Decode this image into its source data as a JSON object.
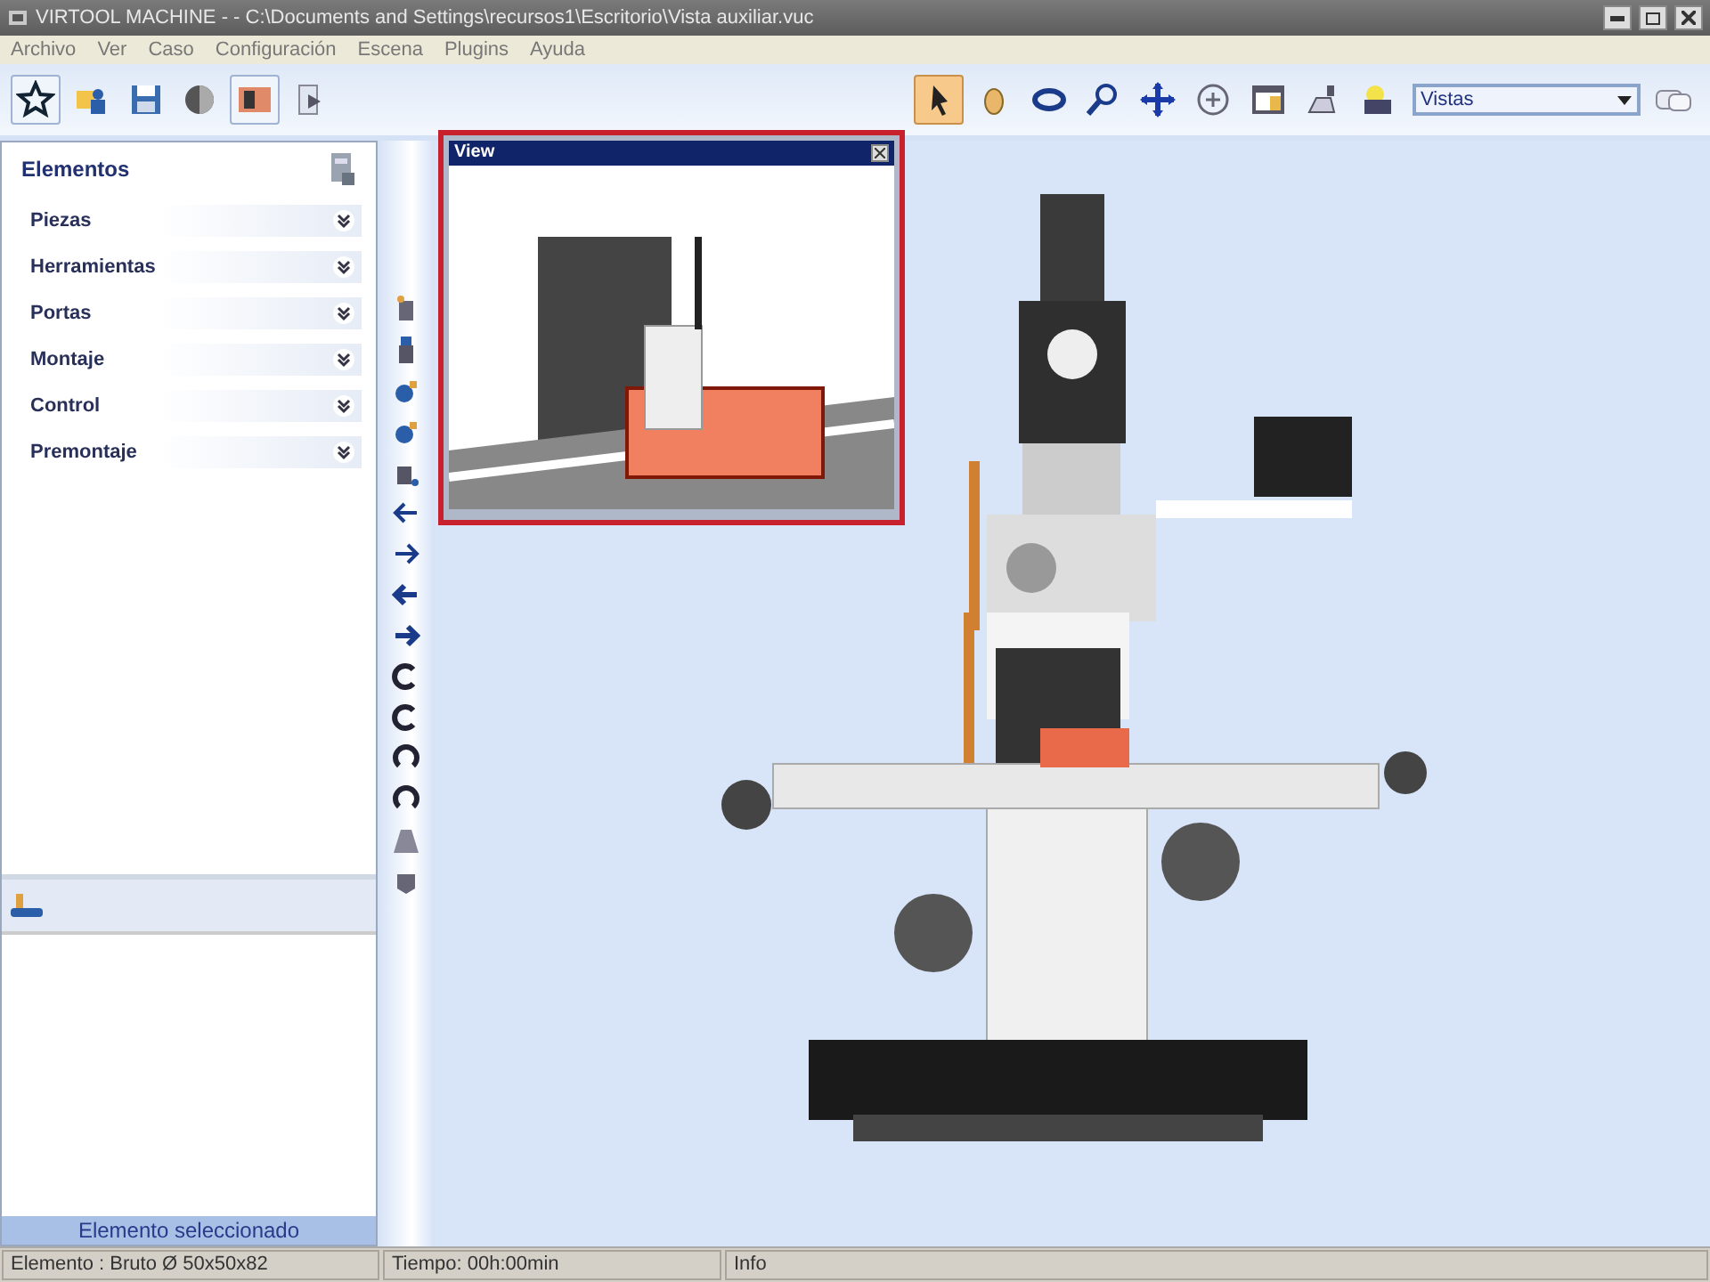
{
  "window": {
    "title": "VIRTOOL MACHINE - - C:\\Documents and Settings\\recursos1\\Escritorio\\Vista auxiliar.vuc"
  },
  "menu": [
    "Archivo",
    "Ver",
    "Caso",
    "Configuración",
    "Escena",
    "Plugins",
    "Ayuda"
  ],
  "file_toolbar": [
    {
      "selected": true
    },
    {
      "selected": false
    },
    {
      "selected": false
    },
    {
      "selected": false
    },
    {
      "selected": true
    },
    {
      "selected": false
    }
  ],
  "view_toolbar": [
    {
      "selected": true
    },
    {
      "selected": false
    },
    {
      "selected": false
    },
    {
      "selected": false
    },
    {
      "selected": false
    },
    {
      "selected": false
    },
    {
      "selected": false
    },
    {
      "selected": false
    },
    {
      "selected": false
    }
  ],
  "views_dropdown": {
    "value": "Vistas"
  },
  "sidebar": {
    "title": "Elementos",
    "sections": [
      {
        "label": "Piezas",
        "expanded": false
      },
      {
        "label": "Herramientas",
        "expanded": false
      },
      {
        "label": "Portas",
        "expanded": false
      },
      {
        "label": "Montaje",
        "expanded": false
      },
      {
        "label": "Control",
        "expanded": false
      },
      {
        "label": "Premontaje",
        "expanded": false
      }
    ],
    "selected_panel": {
      "footer": "Elemento seleccionado"
    }
  },
  "aux_view": {
    "title": "View"
  },
  "status_bar": [
    "Elemento : Bruto Ø 50x50x82",
    "Tiempo: 00h:00min",
    "Info"
  ]
}
